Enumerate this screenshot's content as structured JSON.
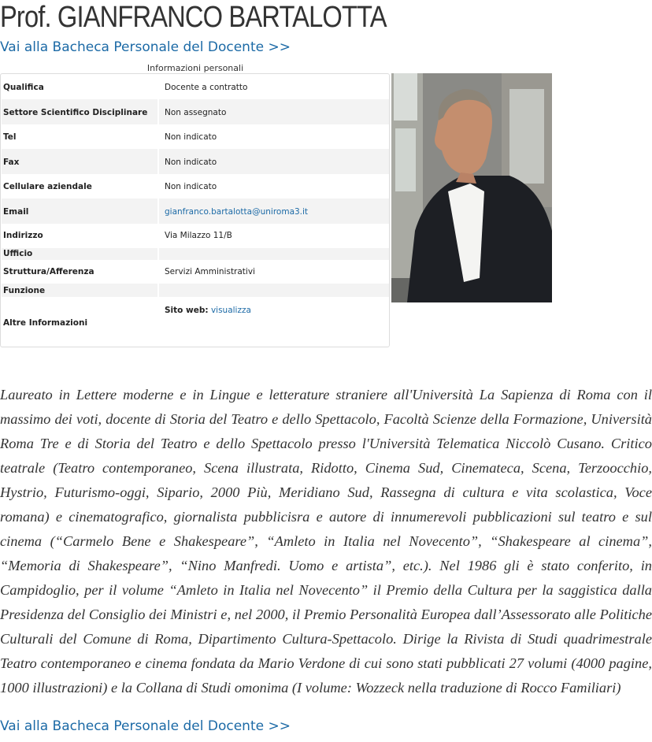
{
  "header": {
    "title": "Prof. GIANFRANCO BARTALOTTA",
    "bacheca_link": "Vai alla Bacheca Personale del Docente >>"
  },
  "info": {
    "caption": "Informazioni personali",
    "rows": [
      {
        "label": "Qualifica",
        "value": "Docente a contratto"
      },
      {
        "label": "Settore Scientifico Disciplinare",
        "value": "Non assegnato"
      },
      {
        "label": "Tel",
        "value": "Non indicato"
      },
      {
        "label": "Fax",
        "value": "Non indicato"
      },
      {
        "label": "Cellulare aziendale",
        "value": "Non indicato"
      },
      {
        "label": "Email",
        "value": "gianfranco.bartalotta@uniroma3.it"
      },
      {
        "label": "Indirizzo",
        "value": "Via Milazzo 11/B"
      },
      {
        "label": "Ufficio",
        "value": ""
      },
      {
        "label": "Struttura/Afferenza",
        "value": "Servizi Amministrativi"
      },
      {
        "label": "Funzione",
        "value": ""
      },
      {
        "label": "Altre Informazioni",
        "value_prefix": "Sito web:",
        "value_link": "visualizza"
      }
    ]
  },
  "bio": "Laureato in Lettere moderne e in Lingue e letterature straniere all'Università La Sapienza di Roma con il massimo dei voti, docente di Storia del Teatro e dello Spettacolo, Facoltà Scienze della Formazione, Università Roma Tre e di Storia del Teatro e dello Spettacolo presso l'Università Telematica Niccolò Cusano. Critico teatrale (Teatro contemporaneo, Scena illustrata, Ridotto, Cinema Sud, Cinemateca, Scena, Terzoocchio, Hystrio, Futurismo-oggi, Sipario, 2000 Più, Meridiano Sud, Rassegna di cultura e vita scolastica, Voce romana) e cinematografico, giornalista pubblicisra e autore di innumerevoli pubblicazioni sul teatro e sul cinema (“Carmelo Bene e Shakespeare”, “Amleto in Italia nel Novecento”, “Shakespeare al cinema”, “Memoria di Shakespeare”, “Nino Manfredi. Uomo e artista”, etc.). Nel 1986 gli è stato conferito, in Campidoglio, per il volume “Amleto in Italia nel Novecento” il Premio della Cultura per la saggistica dalla Presidenza del Consiglio dei Ministri e, nel 2000, il Premio Personalità Europea dall’Assessorato alle Politiche Culturali del Comune di Roma, Dipartimento Cultura-Spettacolo. Dirige la Rivista di Studi quadrimestrale Teatro contemporaneo e cinema fondata da Mario Verdone di cui sono stati pubblicati 27 volumi (4000 pagine, 1000 illustrazioni) e la Collana di Studi omonima (I volume: Wozzeck nella traduzione di Rocco Familiari)",
  "colors": {
    "link": "#1c6aa6",
    "row_alt": "#f3f3f3",
    "border": "#dcdcdc"
  }
}
